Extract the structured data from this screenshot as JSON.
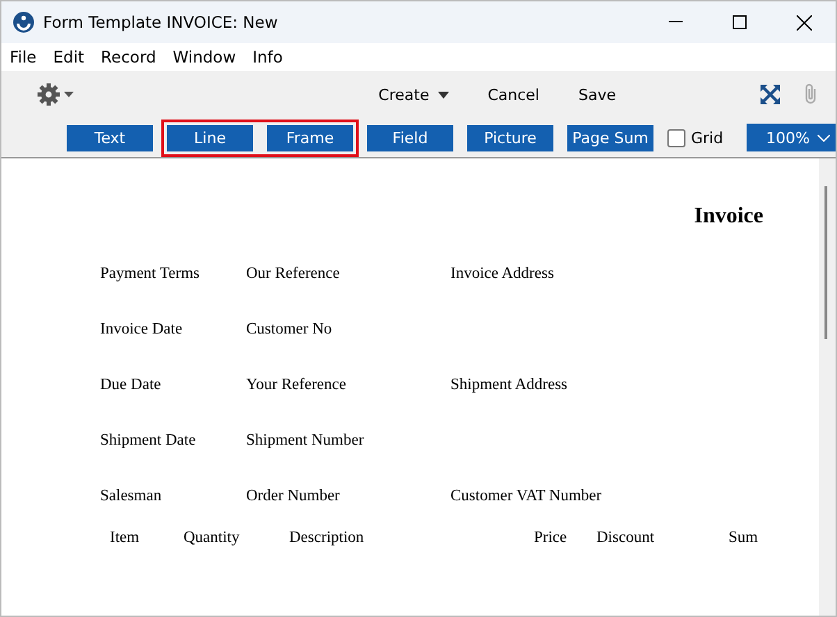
{
  "window": {
    "title": "Form Template INVOICE: New"
  },
  "menu": [
    "File",
    "Edit",
    "Record",
    "Window",
    "Info"
  ],
  "toolbar": {
    "actions": [
      {
        "label": "Create",
        "dropdown": true
      },
      {
        "label": "Cancel",
        "dropdown": false
      },
      {
        "label": "Save",
        "dropdown": false
      }
    ]
  },
  "tool_groups": [
    {
      "highlighted": false,
      "buttons": [
        "Text"
      ]
    },
    {
      "highlighted": true,
      "buttons": [
        "Line",
        "Frame"
      ]
    },
    {
      "highlighted": false,
      "buttons": [
        "Field",
        "Picture",
        "Page Sum"
      ]
    }
  ],
  "grid": {
    "label": "Grid",
    "checked": false
  },
  "zoom": {
    "value": "100%"
  },
  "form": {
    "title": "Invoice",
    "header_rows": [
      {
        "cells": [
          "Payment Terms",
          "Our Reference",
          "Invoice Address"
        ]
      },
      {
        "cells": [
          "Invoice Date",
          "Customer No"
        ]
      },
      {
        "cells": [
          "Due Date",
          "Your Reference",
          "Shipment Address"
        ]
      },
      {
        "cells": [
          "Shipment Date",
          "Shipment Number"
        ]
      },
      {
        "cells": [
          "Salesman",
          "Order Number",
          "Customer VAT Number"
        ]
      }
    ],
    "columns": [
      "Item",
      "Quantity",
      "Description",
      "Price",
      "Discount",
      "Sum"
    ]
  }
}
